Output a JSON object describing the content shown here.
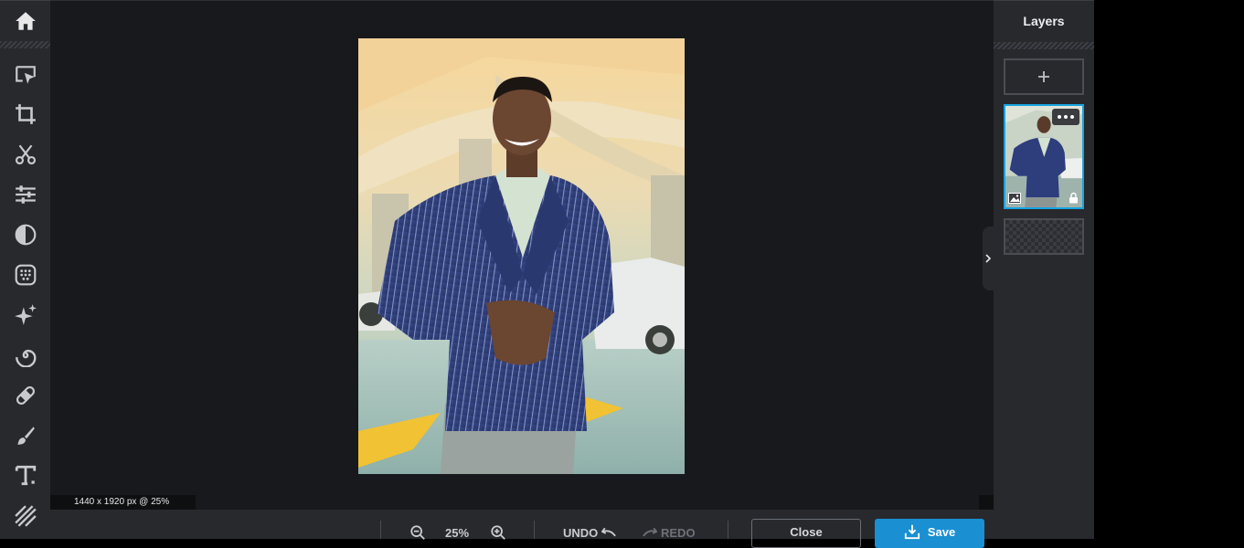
{
  "toolbar": {
    "icons": [
      "home-icon",
      "arrange-icon",
      "crop-icon",
      "cutout-icon",
      "adjust-icon",
      "filter-icon",
      "effects-icon",
      "liquify-icon",
      "spiral-icon",
      "heal-icon",
      "brush-icon",
      "text-icon",
      "hatch-icon"
    ]
  },
  "canvas": {
    "dimensions_label": "1440 x 1920 px @ 25%"
  },
  "bottombar": {
    "zoom_value": "25%",
    "undo_label": "UNDO",
    "redo_label": "REDO",
    "close_label": "Close",
    "save_label": "Save"
  },
  "layers": {
    "title": "Layers",
    "add_icon": "plus-icon",
    "menu_icon": "more-icon"
  },
  "colors": {
    "accent": "#1a8fd1",
    "selected_layer_border": "#18a3e0",
    "panel_bg": "#27292d",
    "canvas_bg": "#18191c"
  }
}
